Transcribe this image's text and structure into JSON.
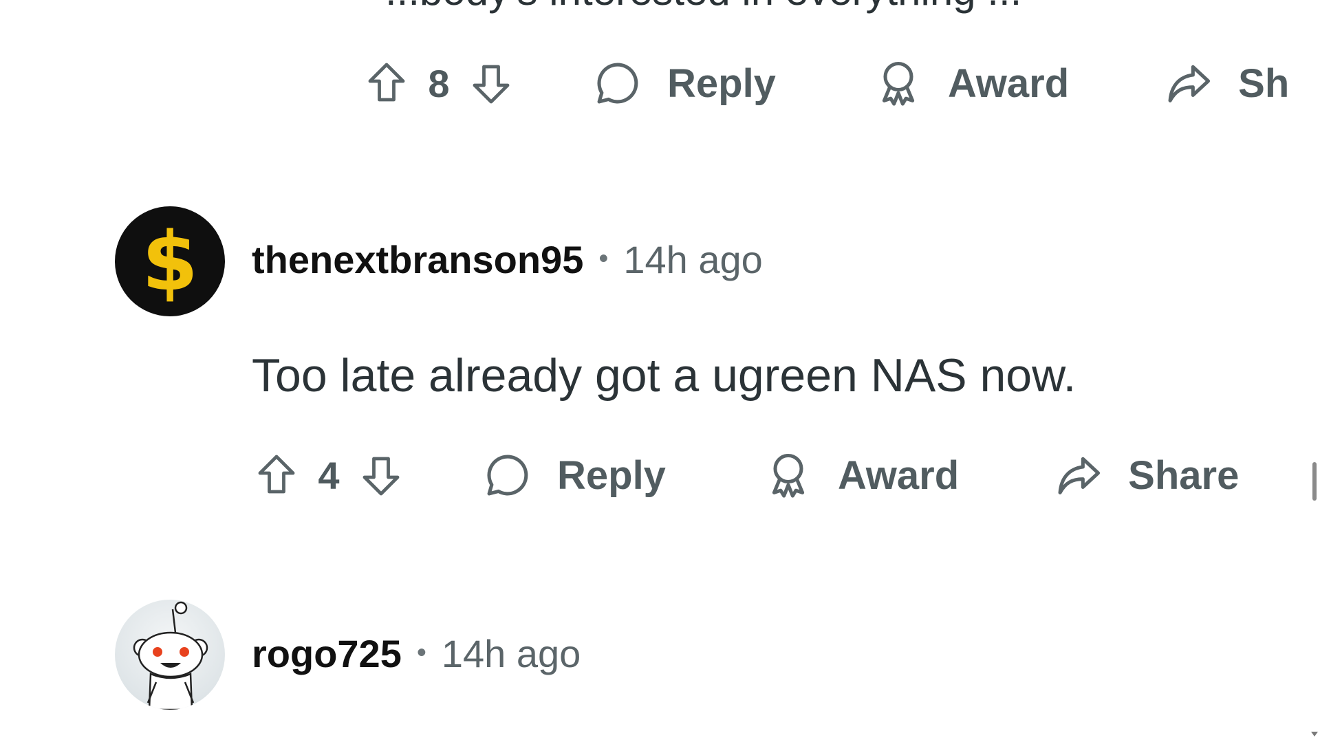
{
  "top_clipped_text": "...body's interested in everything ...",
  "comments": [
    {
      "actions": {
        "vote_count": "8",
        "reply_label": "Reply",
        "award_label": "Award",
        "share_label": "Sh"
      }
    },
    {
      "username": "thenextbranson95",
      "separator": "•",
      "timestamp": "14h ago",
      "avatar_glyph": "$",
      "body": "Too late already got a ugreen NAS now.",
      "actions": {
        "vote_count": "4",
        "reply_label": "Reply",
        "award_label": "Award",
        "share_label": "Share"
      }
    },
    {
      "username": "rogo725",
      "separator": "•",
      "timestamp": "14h ago"
    }
  ],
  "colors": {
    "avatar_dollar_bg": "#0f0f0f",
    "avatar_dollar_glyph": "#f2c10b",
    "action_text": "#515c60"
  },
  "icons": [
    "upvote-icon",
    "downvote-icon",
    "reply-bubble-icon",
    "award-icon",
    "share-arrow-icon",
    "dollar-icon",
    "snoo-icon"
  ]
}
